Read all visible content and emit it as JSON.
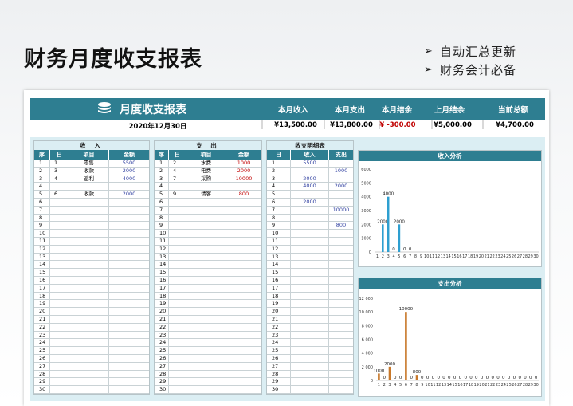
{
  "page": {
    "title": "财务月度收支报表",
    "features": [
      "自动汇总更新",
      "财务会计必备"
    ],
    "arrow": "➢"
  },
  "header": {
    "title": "月度收支报表",
    "icon": "coins-stack-icon",
    "columns": [
      "本月收入",
      "本月支出",
      "本月结余",
      "上月结余",
      "当前总额"
    ],
    "date": "2020年12月30日",
    "values": [
      "¥13,500.00",
      "¥13,800.00",
      "¥ -300.00",
      "¥5,000.00",
      "¥4,700.00"
    ]
  },
  "income": {
    "caption": "收 入",
    "headers": [
      "序",
      "日",
      "项目",
      "金额"
    ],
    "rows": [
      [
        "1",
        "1",
        "零售",
        "5500"
      ],
      [
        "2",
        "3",
        "收款",
        "2000"
      ],
      [
        "3",
        "4",
        "返利",
        "4000"
      ],
      [
        "4",
        "",
        "",
        ""
      ],
      [
        "5",
        "6",
        "收款",
        "2000"
      ],
      [
        "6",
        "",
        "",
        ""
      ],
      [
        "7",
        "",
        "",
        ""
      ],
      [
        "8",
        "",
        "",
        ""
      ],
      [
        "9",
        "",
        "",
        ""
      ],
      [
        "10",
        "",
        "",
        ""
      ],
      [
        "11",
        "",
        "",
        ""
      ],
      [
        "12",
        "",
        "",
        ""
      ],
      [
        "13",
        "",
        "",
        ""
      ],
      [
        "14",
        "",
        "",
        ""
      ],
      [
        "15",
        "",
        "",
        ""
      ],
      [
        "16",
        "",
        "",
        ""
      ],
      [
        "17",
        "",
        "",
        ""
      ],
      [
        "18",
        "",
        "",
        ""
      ],
      [
        "19",
        "",
        "",
        ""
      ],
      [
        "20",
        "",
        "",
        ""
      ],
      [
        "21",
        "",
        "",
        ""
      ],
      [
        "22",
        "",
        "",
        ""
      ],
      [
        "23",
        "",
        "",
        ""
      ],
      [
        "24",
        "",
        "",
        ""
      ],
      [
        "25",
        "",
        "",
        ""
      ],
      [
        "26",
        "",
        "",
        ""
      ],
      [
        "27",
        "",
        "",
        ""
      ],
      [
        "28",
        "",
        "",
        ""
      ],
      [
        "29",
        "",
        "",
        ""
      ],
      [
        "30",
        "",
        "",
        ""
      ]
    ]
  },
  "expense": {
    "caption": "支 出",
    "headers": [
      "序",
      "日",
      "项目",
      "金额"
    ],
    "rows": [
      [
        "1",
        "2",
        "水费",
        "1000"
      ],
      [
        "2",
        "4",
        "电费",
        "2000"
      ],
      [
        "3",
        "7",
        "采购",
        "10000"
      ],
      [
        "4",
        "",
        "",
        ""
      ],
      [
        "5",
        "9",
        "请客",
        "800"
      ],
      [
        "6",
        "",
        "",
        ""
      ],
      [
        "7",
        "",
        "",
        ""
      ],
      [
        "8",
        "",
        "",
        ""
      ],
      [
        "9",
        "",
        "",
        ""
      ],
      [
        "10",
        "",
        "",
        ""
      ],
      [
        "11",
        "",
        "",
        ""
      ],
      [
        "12",
        "",
        "",
        ""
      ],
      [
        "13",
        "",
        "",
        ""
      ],
      [
        "14",
        "",
        "",
        ""
      ],
      [
        "15",
        "",
        "",
        ""
      ],
      [
        "16",
        "",
        "",
        ""
      ],
      [
        "17",
        "",
        "",
        ""
      ],
      [
        "18",
        "",
        "",
        ""
      ],
      [
        "19",
        "",
        "",
        ""
      ],
      [
        "20",
        "",
        "",
        ""
      ],
      [
        "21",
        "",
        "",
        ""
      ],
      [
        "22",
        "",
        "",
        ""
      ],
      [
        "23",
        "",
        "",
        ""
      ],
      [
        "24",
        "",
        "",
        ""
      ],
      [
        "25",
        "",
        "",
        ""
      ],
      [
        "26",
        "",
        "",
        ""
      ],
      [
        "27",
        "",
        "",
        ""
      ],
      [
        "28",
        "",
        "",
        ""
      ],
      [
        "29",
        "",
        "",
        ""
      ],
      [
        "30",
        "",
        "",
        ""
      ]
    ]
  },
  "detail": {
    "caption": "收支明细表",
    "headers": [
      "日",
      "收入",
      "支出"
    ],
    "rows": [
      [
        "1",
        "5500",
        ""
      ],
      [
        "2",
        "",
        "1000"
      ],
      [
        "3",
        "2000",
        ""
      ],
      [
        "4",
        "4000",
        "2000"
      ],
      [
        "5",
        "",
        ""
      ],
      [
        "6",
        "2000",
        ""
      ],
      [
        "7",
        "",
        "10000"
      ],
      [
        "8",
        "",
        ""
      ],
      [
        "9",
        "",
        "800"
      ],
      [
        "10",
        "",
        ""
      ],
      [
        "11",
        "",
        ""
      ],
      [
        "12",
        "",
        ""
      ],
      [
        "13",
        "",
        ""
      ],
      [
        "14",
        "",
        ""
      ],
      [
        "15",
        "",
        ""
      ],
      [
        "16",
        "",
        ""
      ],
      [
        "17",
        "",
        ""
      ],
      [
        "18",
        "",
        ""
      ],
      [
        "19",
        "",
        ""
      ],
      [
        "20",
        "",
        ""
      ],
      [
        "21",
        "",
        ""
      ],
      [
        "22",
        "",
        ""
      ],
      [
        "23",
        "",
        ""
      ],
      [
        "24",
        "",
        ""
      ],
      [
        "25",
        "",
        ""
      ],
      [
        "26",
        "",
        ""
      ],
      [
        "27",
        "",
        ""
      ],
      [
        "28",
        "",
        ""
      ],
      [
        "29",
        "",
        ""
      ],
      [
        "30",
        "",
        ""
      ]
    ]
  },
  "colors": {
    "accent": "#2e7e91",
    "panel": "#dbeef3",
    "income_bar": "#2e9fd0",
    "expense_bar": "#c8782a",
    "negative": "#c00000",
    "amount": "#2f3fa0"
  },
  "chart_data": [
    {
      "type": "bar",
      "title": "收入分析",
      "categories": [
        "1",
        "2",
        "3",
        "4",
        "5",
        "6",
        "7",
        "8",
        "9",
        "10",
        "11",
        "12",
        "13",
        "14",
        "15",
        "16",
        "17",
        "18",
        "19",
        "20",
        "21",
        "22",
        "23",
        "24",
        "25",
        "26",
        "27",
        "28",
        "29",
        "30"
      ],
      "values": [
        0,
        2000,
        4000,
        0,
        2000,
        0,
        0,
        0,
        0,
        0,
        0,
        0,
        0,
        0,
        0,
        0,
        0,
        0,
        0,
        0,
        0,
        0,
        0,
        0,
        0,
        0,
        0,
        0,
        0,
        0
      ],
      "data_labels": [
        "",
        "2000",
        "4000",
        "0",
        "2000",
        "0",
        "0",
        "",
        "",
        "",
        "",
        "",
        "",
        "",
        "",
        "",
        "",
        "",
        "",
        "",
        "",
        "",
        "",
        "",
        "",
        "",
        "",
        "",
        "",
        ""
      ],
      "yticks": [
        "0",
        "1000",
        "2000",
        "3000",
        "4000",
        "5000",
        "6000"
      ],
      "ylim": [
        0,
        6000
      ]
    },
    {
      "type": "bar",
      "title": "支出分析",
      "categories": [
        "1",
        "2",
        "3",
        "4",
        "5",
        "6",
        "7",
        "8",
        "9",
        "10",
        "11",
        "12",
        "13",
        "14",
        "15",
        "16",
        "17",
        "18",
        "19",
        "20",
        "21",
        "22",
        "23",
        "24",
        "25",
        "26",
        "27",
        "28",
        "29",
        "30"
      ],
      "values": [
        1000,
        0,
        2000,
        0,
        0,
        10000,
        0,
        800,
        0,
        0,
        0,
        0,
        0,
        0,
        0,
        0,
        0,
        0,
        0,
        0,
        0,
        0,
        0,
        0,
        0,
        0,
        0,
        0,
        0,
        0
      ],
      "data_labels": [
        "1000",
        "0",
        "2000",
        "0",
        "0",
        "10000",
        "0",
        "800",
        "0",
        "0",
        "0",
        "0",
        "0",
        "0",
        "0",
        "0",
        "0",
        "0",
        "0",
        "0",
        "0",
        "0",
        "0",
        "0",
        "0",
        "0",
        "0",
        "0",
        "0",
        "0"
      ],
      "yticks": [
        "0",
        "2 000",
        "4 000",
        "6 000",
        "8 000",
        "10 000",
        "12 000"
      ],
      "ylim": [
        0,
        12000
      ]
    }
  ]
}
